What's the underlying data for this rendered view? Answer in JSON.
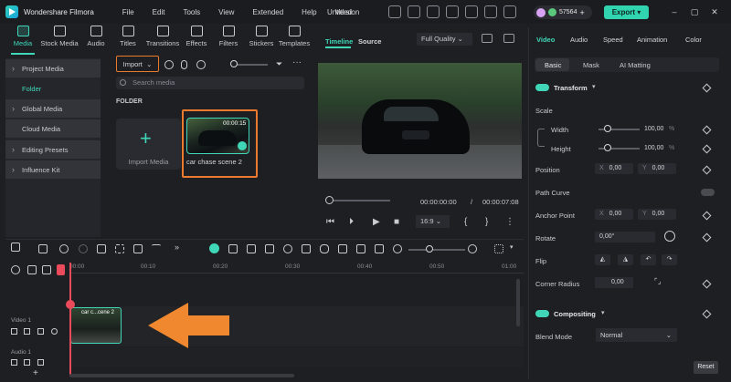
{
  "app": {
    "name": "Wondershare Filmora",
    "doc_title": "Untitled"
  },
  "menu": [
    "File",
    "Edit",
    "Tools",
    "View",
    "Extended",
    "Help",
    "Version"
  ],
  "credits": "57564",
  "export_label": "Export",
  "toolbar": [
    {
      "label": "Media",
      "icon": "media-icon",
      "active": true
    },
    {
      "label": "Stock Media",
      "icon": "stock-media-icon"
    },
    {
      "label": "Audio",
      "icon": "audio-icon"
    },
    {
      "label": "Titles",
      "icon": "titles-icon"
    },
    {
      "label": "Transitions",
      "icon": "transitions-icon"
    },
    {
      "label": "Effects",
      "icon": "effects-icon"
    },
    {
      "label": "Filters",
      "icon": "filters-icon"
    },
    {
      "label": "Stickers",
      "icon": "stickers-icon"
    },
    {
      "label": "Templates",
      "icon": "templates-icon"
    }
  ],
  "sidebar": {
    "items": [
      "Project Media",
      "Folder",
      "Global Media",
      "Cloud Media",
      "Editing Presets",
      "Influence Kit"
    ]
  },
  "media": {
    "import_label": "Import",
    "search_placeholder": "Search media",
    "folder_heading": "FOLDER",
    "import_media_label": "Import Media",
    "clip": {
      "name": "car chase scene 2",
      "duration": "00:00:15"
    }
  },
  "preview": {
    "tab_timeline": "Timeline",
    "tab_source": "Source",
    "quality": "Full Quality",
    "current_time": "00:00:00:00",
    "separator": "/",
    "total_time": "00:00:07:08",
    "ratio": "16:9"
  },
  "inspector": {
    "tabs": [
      "Video",
      "Audio",
      "Speed",
      "Animation",
      "Color"
    ],
    "subtabs": [
      "Basic",
      "Mask",
      "AI Matting"
    ],
    "transform": "Transform",
    "scale": "Scale",
    "width_label": "Width",
    "width_value": "100,00",
    "height_label": "Height",
    "height_value": "100,00",
    "percent": "%",
    "position": "Position",
    "pos_x": "0,00",
    "pos_y": "0,00",
    "path_curve": "Path Curve",
    "anchor_point": "Anchor Point",
    "anchor_x": "0,00",
    "anchor_y": "0,00",
    "rotate": "Rotate",
    "rotate_value": "0,00°",
    "flip": "Flip",
    "corner_radius": "Corner Radius",
    "corner_value": "0,00",
    "compositing": "Compositing",
    "blend_mode": "Blend Mode",
    "blend_value": "Normal",
    "reset": "Reset",
    "axis_x": "X",
    "axis_y": "Y"
  },
  "timeline": {
    "ruler": [
      "00:00",
      "00:10",
      "00:20",
      "00:30",
      "00:40",
      "00:50",
      "01:00"
    ],
    "clip_name": "car c...cene 2",
    "video_track": "Video 1",
    "audio_track": "Audio 1"
  },
  "colors": {
    "accent": "#3fd7b7",
    "highlight": "#ea7a2e",
    "arrow": "#f0882f",
    "playhead": "#ea4a5a"
  }
}
